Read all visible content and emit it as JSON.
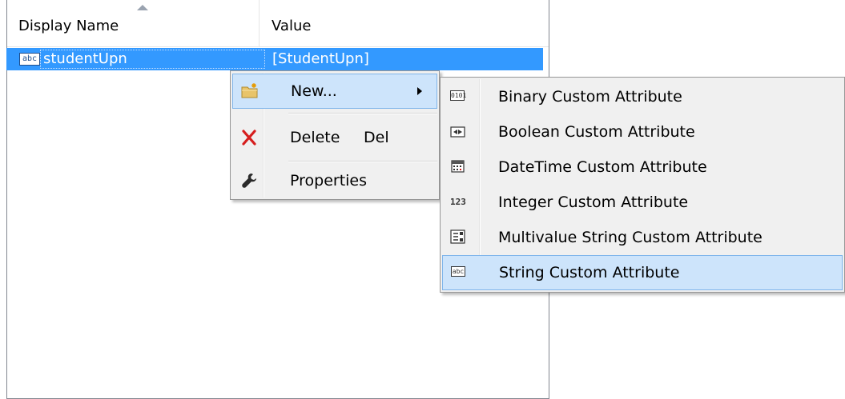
{
  "list": {
    "columns": {
      "display_name": "Display Name",
      "value": "Value"
    },
    "rows": [
      {
        "icon": "abc",
        "display_name": "studentUpn",
        "value": "[StudentUpn]"
      }
    ]
  },
  "context_menu": {
    "items": [
      {
        "label": "New...",
        "icon": "new-folder-icon",
        "has_submenu": true,
        "highlighted": true
      },
      {
        "label": "Delete",
        "shortcut": "Del",
        "icon": "delete-x-icon"
      },
      {
        "label": "Properties",
        "icon": "wrench-icon"
      }
    ]
  },
  "submenu": {
    "items": [
      {
        "label": "Binary Custom Attribute",
        "icon": "binary-icon",
        "icon_text": "0101"
      },
      {
        "label": "Boolean Custom Attribute",
        "icon": "boolean-icon"
      },
      {
        "label": "DateTime Custom Attribute",
        "icon": "calendar-icon"
      },
      {
        "label": "Integer Custom Attribute",
        "icon": "integer-icon",
        "icon_text": "123"
      },
      {
        "label": "Multivalue String Custom Attribute",
        "icon": "multivalue-icon"
      },
      {
        "label": "String Custom Attribute",
        "icon": "string-icon",
        "icon_text": "abc",
        "highlighted": true
      }
    ]
  },
  "colors": {
    "selection": "#3399ff",
    "menu_highlight": "#cde4fb",
    "menu_highlight_border": "#7eb4ea",
    "menu_background": "#f0f0f0"
  }
}
